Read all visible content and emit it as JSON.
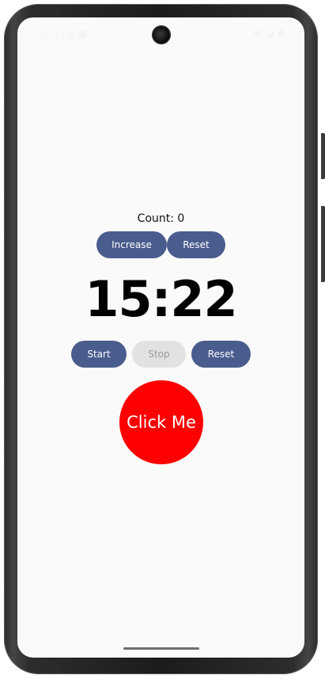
{
  "status_bar": {
    "time": "10:10",
    "left_icons": [
      "settings-icon",
      "sd-card-icon"
    ],
    "right_icons": [
      "wifi-icon",
      "signal-icon",
      "battery-icon"
    ]
  },
  "counter": {
    "label": "Count: 0",
    "increase_label": "Increase",
    "reset_label": "Reset"
  },
  "stopwatch": {
    "time": "15:22",
    "start_label": "Start",
    "stop_label": "Stop",
    "stop_enabled": false,
    "reset_label": "Reset"
  },
  "click_button": {
    "label": "Click Me",
    "color": "#ff0000"
  },
  "colors": {
    "button_primary": "#4a5c8e",
    "button_disabled": "#e2e2e2",
    "screen_background": "#fafafa"
  }
}
